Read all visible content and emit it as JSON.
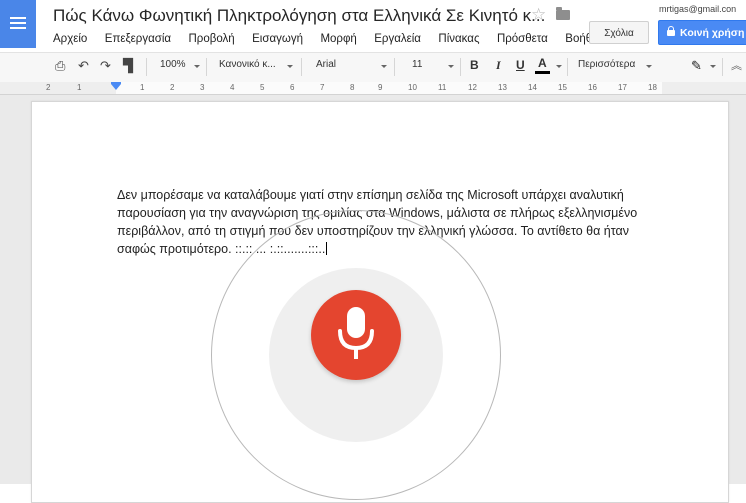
{
  "header": {
    "title": "Πώς Κάνω Φωνητική Πληκτρολόγηση στα Ελληνικά Σε Κινητό κ...",
    "user_email": "mrtigas@gmail.con",
    "comments_label": "Σχόλια",
    "share_label": "Κοινή χρήση"
  },
  "menu": [
    "Αρχείο",
    "Επεξεργασία",
    "Προβολή",
    "Εισαγωγή",
    "Μορφή",
    "Εργαλεία",
    "Πίνακας",
    "Πρόσθετα",
    "Βοήθεια"
  ],
  "toolbar": {
    "zoom": "100%",
    "style": "Κανονικό κ...",
    "font": "Arial",
    "size": "11",
    "bold": "B",
    "italic": "I",
    "underline": "U",
    "text_color": "A",
    "more": "Περισσότερα"
  },
  "ruler": [
    "2",
    "1",
    "1",
    "2",
    "3",
    "4",
    "5",
    "6",
    "7",
    "8",
    "9",
    "10",
    "11",
    "12",
    "13",
    "14",
    "15",
    "16",
    "17",
    "18"
  ],
  "document": {
    "lines": [
      "Δεν μπορέσαμε να καταλάβουμε γιατί στην επίσημη σελίδα της Microsoft υπάρχει αναλυτική",
      "παρουσίαση για την αναγνώριση της ομιλίας στα Windows, μάλιστα σε πλήρως εξελληνισμένο",
      "περιβάλλον,  από τη στιγμή που δεν υποστηρίζουν την  ελληνική γλώσσα. Το αντίθετο θα ήταν",
      "σαφώς  προτιμότερο.  ::.:: ... :.::.......:::.."
    ]
  },
  "voice": {
    "icon": "microphone-icon",
    "state": "listening"
  },
  "colors": {
    "docs_blue": "#4a86e8",
    "share_blue": "#4a8af4",
    "mic_red": "#e4452f"
  }
}
